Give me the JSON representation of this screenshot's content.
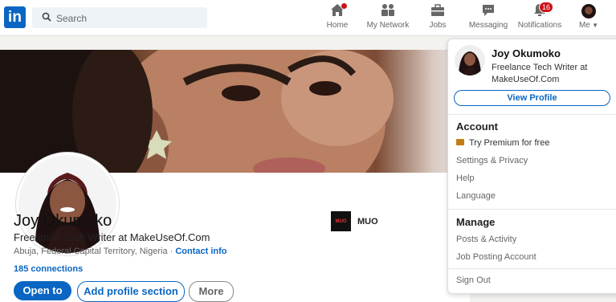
{
  "topbar": {
    "logo": "in",
    "search_placeholder": "Search",
    "nav": [
      {
        "label": "Home",
        "icon": "home-icon"
      },
      {
        "label": "My Network",
        "icon": "network-icon"
      },
      {
        "label": "Jobs",
        "icon": "briefcase-icon"
      },
      {
        "label": "Messaging",
        "icon": "chat-icon"
      },
      {
        "label": "Notifications",
        "icon": "bell-icon",
        "badge": "16"
      },
      {
        "label": "Me",
        "icon": "me-avatar"
      }
    ]
  },
  "profile": {
    "name": "Joy Okumoko",
    "headline": "Freelance Tech Writer at MakeUseOf.Com",
    "location": "Abuja, Federal Capital Territory, Nigeria",
    "location_sep": " · ",
    "contact_info": "Contact info",
    "connections": "185 connections",
    "buttons": {
      "open_to": "Open to",
      "add_section": "Add profile section",
      "more": "More"
    },
    "company": {
      "logo_text": "MUO",
      "name": "MUO"
    }
  },
  "dropdown": {
    "name": "Joy Okumoko",
    "headline": "Freelance Tech Writer at MakeUseOf.Com",
    "view_profile": "View Profile",
    "account_title": "Account",
    "account_items": [
      "Try Premium for free",
      "Settings & Privacy",
      "Help",
      "Language"
    ],
    "manage_title": "Manage",
    "manage_items": [
      "Posts & Activity",
      "Job Posting Account"
    ],
    "sign_out": "Sign Out"
  },
  "colors": {
    "brand": "#0a66c2",
    "badge": "#cc1016",
    "premium": "#c37d16"
  }
}
